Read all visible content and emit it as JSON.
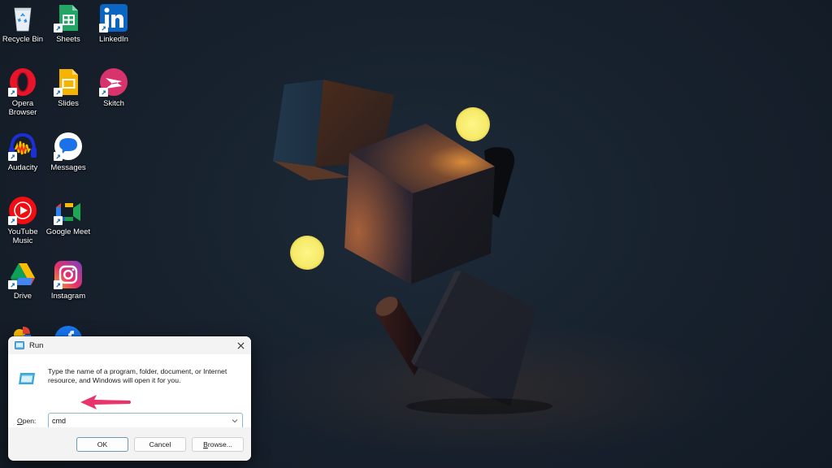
{
  "desktop": {
    "icons": [
      {
        "id": "recycle-bin",
        "label": "Recycle Bin",
        "shortcut": false
      },
      {
        "id": "sheets",
        "label": "Sheets",
        "shortcut": true
      },
      {
        "id": "linkedin",
        "label": "LinkedIn",
        "shortcut": true
      },
      {
        "id": "opera-browser",
        "label": "Opera\nBrowser",
        "shortcut": true
      },
      {
        "id": "slides",
        "label": "Slides",
        "shortcut": true
      },
      {
        "id": "skitch",
        "label": "Skitch",
        "shortcut": true
      },
      {
        "id": "audacity",
        "label": "Audacity",
        "shortcut": true
      },
      {
        "id": "messages",
        "label": "Messages",
        "shortcut": true
      },
      {
        "id": "youtube-music",
        "label": "YouTube\nMusic",
        "shortcut": true
      },
      {
        "id": "google-meet",
        "label": "Google Meet",
        "shortcut": true
      },
      {
        "id": "drive",
        "label": "Drive",
        "shortcut": true
      },
      {
        "id": "instagram",
        "label": "Instagram",
        "shortcut": true
      },
      {
        "id": "google-photos",
        "label": "",
        "shortcut": false
      },
      {
        "id": "facebook",
        "label": "",
        "shortcut": false
      }
    ]
  },
  "run_dialog": {
    "title": "Run",
    "description": "Type the name of a program, folder, document, or Internet resource, and Windows will open it for you.",
    "open_label_accel": "O",
    "open_label_rest": "pen:",
    "open_value": "cmd",
    "buttons": {
      "ok": "OK",
      "cancel": "Cancel",
      "browse_accel": "B",
      "browse_rest": "rowse..."
    }
  },
  "colors": {
    "annotation_arrow": "#e8336b",
    "wallpaper_base": "#131c27",
    "orb": "#fbf27a"
  }
}
